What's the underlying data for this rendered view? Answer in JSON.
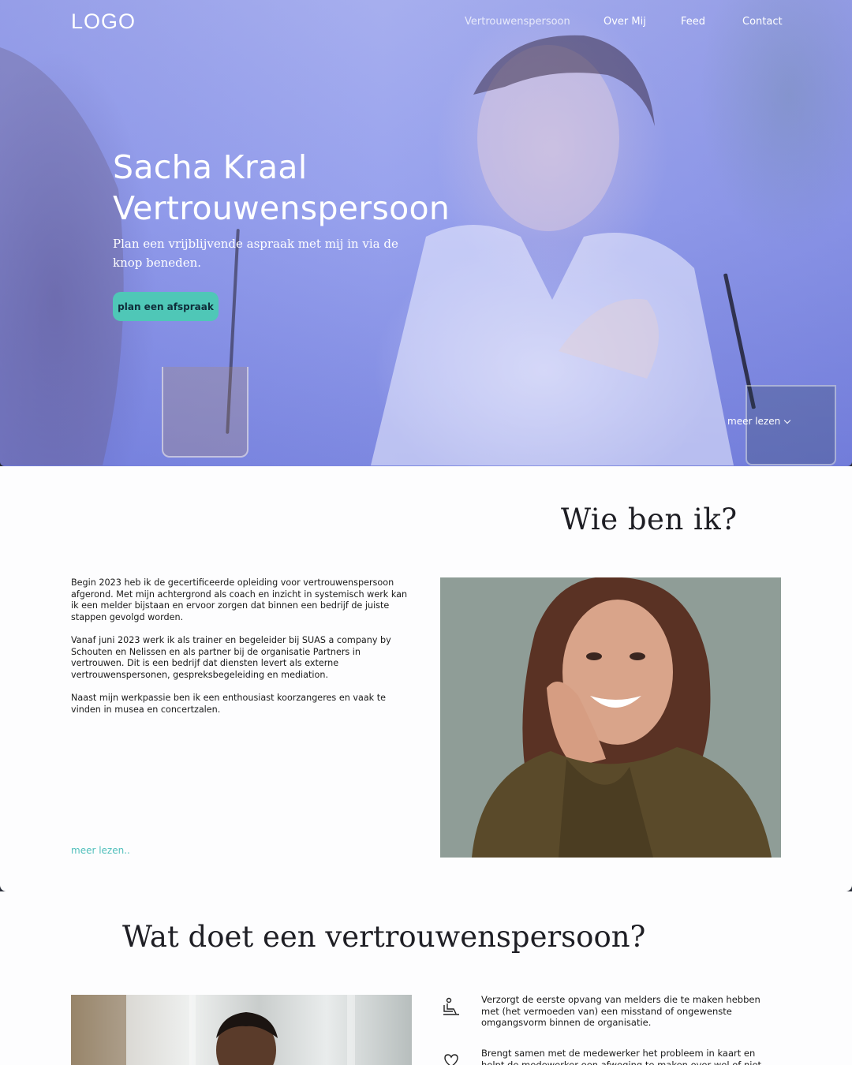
{
  "header": {
    "logo": "LOGO",
    "nav": [
      "Vertrouwenspersoon",
      "Over Mij",
      "Feed",
      "Contact"
    ]
  },
  "hero": {
    "title_line1": "Sacha Kraal",
    "title_line2": "Vertrouwenspersoon",
    "subtitle": "Plan een vrijblijvende aspraak met mij in via de knop beneden.",
    "cta_label": "plan een afspraak",
    "more_label": "meer lezen"
  },
  "about": {
    "heading": "Wie ben ik?",
    "paragraphs": [
      "Begin 2023 heb ik de gecertificeerde opleiding voor vertrouwenspersoon afgerond. Met mijn achtergrond als coach en inzicht in systemisch werk kan ik een melder bijstaan en ervoor zorgen dat binnen een bedrijf de juiste stappen gevolgd worden.",
      "Vanaf juni 2023 werk ik als trainer en begeleider bij SUAS a company by Schouten en Nelissen en als partner bij de organisatie Partners in vertrouwen. Dit is een bedrijf dat diensten levert als externe vertrouwenspersonen, gespreksbegeleiding en mediation.",
      "Naast mijn werkpassie ben ik een enthousiast koorzangeres en vaak te vinden in musea en concertzalen."
    ],
    "read_more": "meer lezen.."
  },
  "what": {
    "heading": "Wat doet een vertrouwenspersoon?",
    "duties": [
      {
        "icon": "person-seated-icon",
        "text": "Verzorgt de eerste opvang van melders die te maken hebben met (het vermoeden van) een misstand of ongewenste omgangsvorm binnen de organisatie."
      },
      {
        "icon": "heart-hands-icon",
        "text": "Brengt samen met de medewerker het probleem in kaart en helpt de medewerker een afweging te maken over wel of niet"
      }
    ]
  },
  "colors": {
    "accent": "#4fc7b7",
    "link": "#4fbfbb",
    "hero_overlay": "#8f99ea"
  }
}
